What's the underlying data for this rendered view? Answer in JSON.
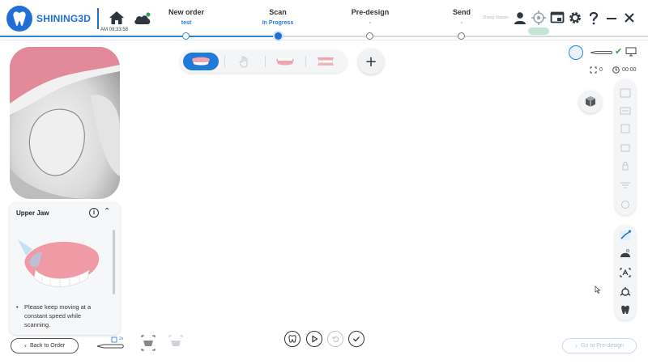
{
  "app": {
    "brand": "SHINING3D",
    "clock": "AM 09:33:58",
    "user_name": "Zhang Xiaoxin"
  },
  "workflow": {
    "steps": [
      {
        "title": "New order",
        "subtitle": "test",
        "state": "done"
      },
      {
        "title": "Scan",
        "subtitle": "In Progress",
        "state": "current"
      },
      {
        "title": "Pre-design",
        "subtitle": "-",
        "state": "pending"
      },
      {
        "title": "Send",
        "subtitle": "-",
        "state": "pending"
      }
    ]
  },
  "header_icons": [
    "home-icon",
    "cloud-sync-icon",
    "user-icon",
    "calibration-target-icon",
    "window-icon",
    "gear-icon",
    "help-icon",
    "minimize-icon",
    "close-icon"
  ],
  "scan_toolbar": {
    "items": [
      "upper-jaw-icon",
      "hand-pose-icon",
      "lower-jaw-icon",
      "bite-icon"
    ],
    "add_label": "+"
  },
  "counters": {
    "shots": "0",
    "time": "00:00"
  },
  "upper_jaw_panel": {
    "title": "Upper Jaw",
    "tip": "Please keep moving at a constant speed while scanning."
  },
  "bottom": {
    "back_label": "Back to Order",
    "next_label": "Go to Pre-design",
    "scanner_badge": "2x"
  },
  "colors": {
    "brand_blue": "#1f6fd6",
    "accent_blue": "#2a86da",
    "status_green": "#2ba14b"
  }
}
